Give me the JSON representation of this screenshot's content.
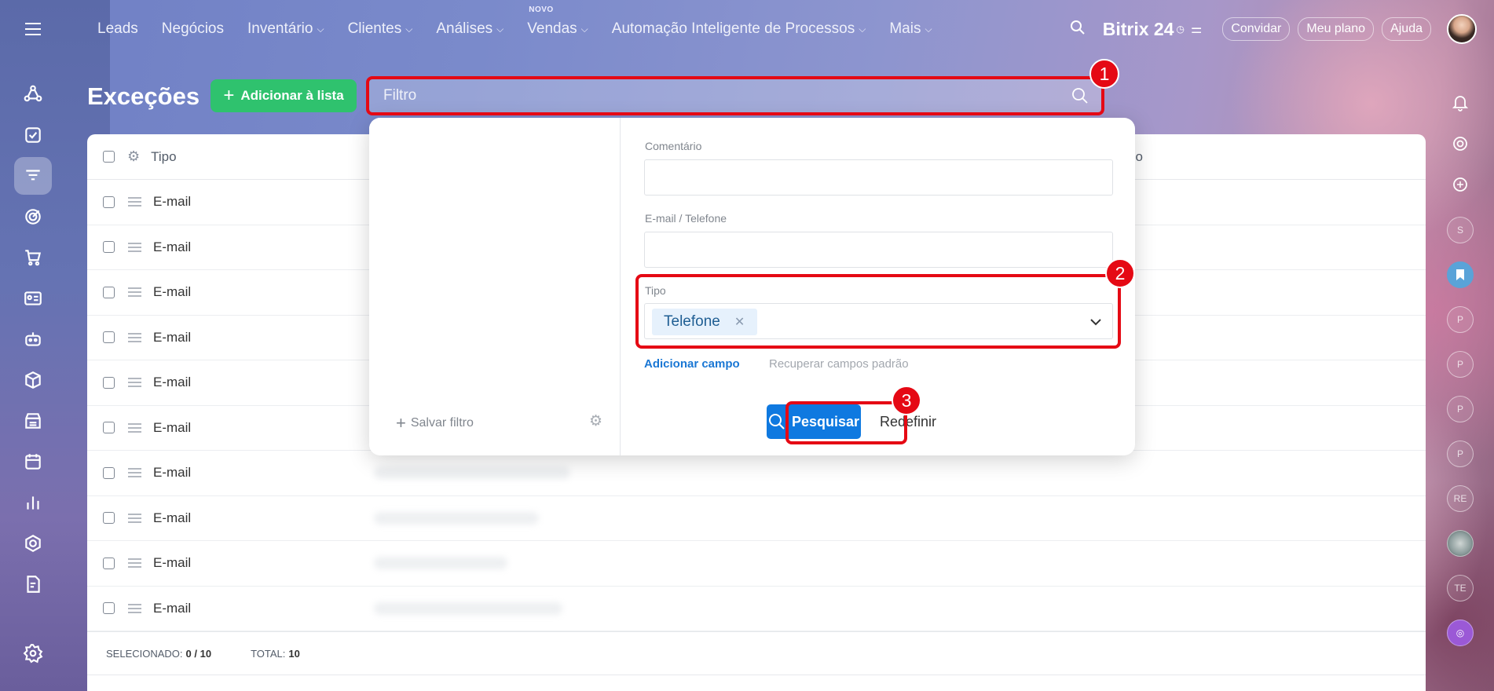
{
  "header": {
    "nav": [
      {
        "label": "Leads",
        "dropdown": false,
        "badge": ""
      },
      {
        "label": "Negócios",
        "dropdown": false,
        "badge": ""
      },
      {
        "label": "Inventário",
        "dropdown": true,
        "badge": ""
      },
      {
        "label": "Clientes",
        "dropdown": true,
        "badge": ""
      },
      {
        "label": "Análises",
        "dropdown": true,
        "badge": ""
      },
      {
        "label": "Vendas",
        "dropdown": true,
        "badge": "NOVO"
      },
      {
        "label": "Automação Inteligente de Processos",
        "dropdown": true,
        "badge": ""
      },
      {
        "label": "Mais",
        "dropdown": true,
        "badge": ""
      }
    ],
    "logo_text": "Bitrix 24",
    "invite_label": "Convidar",
    "plan_label": "Meu plano",
    "help_label": "Ajuda"
  },
  "page": {
    "title": "Exceções",
    "add_button_label": "Adicionar à lista",
    "filter_placeholder": "Filtro"
  },
  "table": {
    "columns": [
      "Tipo",
      "rio"
    ],
    "rows": [
      "E-mail",
      "E-mail",
      "E-mail",
      "E-mail",
      "E-mail",
      "E-mail",
      "E-mail",
      "E-mail",
      "E-mail",
      "E-mail"
    ],
    "footer": {
      "selected_label": "SELECIONADO:",
      "selected_value": "0 / 10",
      "total_label": "TOTAL:",
      "total_value": "10"
    }
  },
  "filter_popup": {
    "save_filter_label": "Salvar filtro",
    "fields": {
      "comment_label": "Comentário",
      "comment_value": "",
      "email_phone_label": "E-mail / Telefone",
      "email_phone_value": "",
      "type_label": "Tipo",
      "type_selected": "Telefone"
    },
    "add_field_label": "Adicionar campo",
    "restore_fields_label": "Recuperar campos padrão",
    "search_button_label": "Pesquisar",
    "reset_button_label": "Redefinir"
  },
  "annotations": [
    "1",
    "2",
    "3"
  ],
  "right_rail": {
    "avatars": [
      "S",
      "",
      "P",
      "P",
      "P",
      "P",
      "RE",
      "",
      "TE",
      ""
    ]
  },
  "colors": {
    "accent_green": "#2fc26e",
    "accent_blue": "#0f79e0",
    "highlight_red": "#e50914"
  }
}
